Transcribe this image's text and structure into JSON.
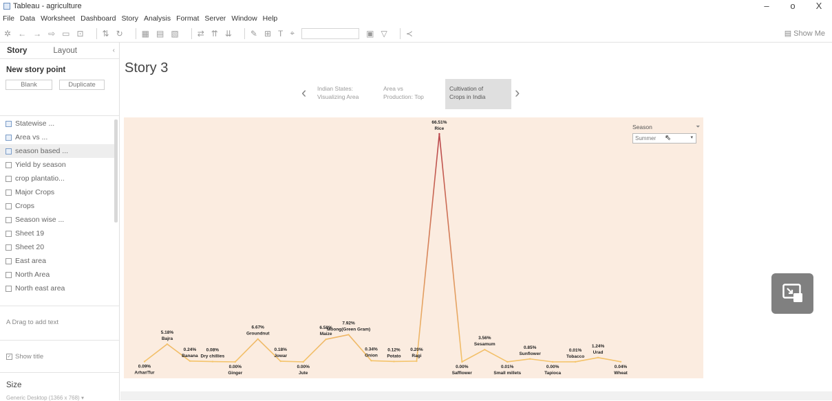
{
  "window": {
    "title": "Tableau - agriculture",
    "controls": [
      "–",
      "o",
      "X"
    ]
  },
  "menu": [
    "File",
    "Data",
    "Worksheet",
    "Dashboard",
    "Story",
    "Analysis",
    "Format",
    "Server",
    "Window",
    "Help"
  ],
  "toolbar": {
    "show_me": "Show Me"
  },
  "panel": {
    "tab_story": "Story",
    "tab_layout": "Layout",
    "new_story_point": "New story point",
    "blank": "Blank",
    "duplicate": "Duplicate",
    "sheets": [
      {
        "label": "Statewise ...",
        "kind": "story"
      },
      {
        "label": "Area vs ...",
        "kind": "story"
      },
      {
        "label": "season based ...",
        "kind": "story",
        "selected": true
      },
      {
        "label": "Yield by season",
        "kind": "sheet"
      },
      {
        "label": "crop plantatio...",
        "kind": "sheet"
      },
      {
        "label": "Major Crops",
        "kind": "sheet"
      },
      {
        "label": "Crops",
        "kind": "sheet"
      },
      {
        "label": "Season wise ...",
        "kind": "sheet"
      },
      {
        "label": "Sheet 19",
        "kind": "sheet"
      },
      {
        "label": "Sheet 20",
        "kind": "sheet"
      },
      {
        "label": "East area",
        "kind": "sheet"
      },
      {
        "label": "North Area",
        "kind": "sheet"
      },
      {
        "label": "North east area",
        "kind": "sheet"
      }
    ],
    "drag_text": "Drag to add text",
    "show_title": "Show title",
    "size_label": "Size",
    "size_value": "Generic Desktop (1366 x 768) ▾"
  },
  "story": {
    "title": "Story 3",
    "points": [
      {
        "line1": "Indian States:",
        "line2": "Visualizing Area"
      },
      {
        "line1": "Area vs",
        "line2": "Production: Top"
      },
      {
        "line1": "Cultivation of",
        "line2": "Crops in India",
        "active": true
      }
    ]
  },
  "filter": {
    "label": "Season",
    "value": "Summer"
  },
  "colors": {
    "canvas_bg": "#fbece0",
    "line_low": "#f5c56a",
    "line_high": "#b8424a"
  },
  "chart_data": {
    "type": "line",
    "categories": [
      "Arhar/Tur",
      "Bajra",
      "Banana",
      "Dry chillies",
      "Ginger",
      "Groundnut",
      "Jowar",
      "Jute",
      "Maize",
      "Moong(Green Gram)",
      "Onion",
      "Potato",
      "Ragi",
      "Rice",
      "Safflower",
      "Sesamum",
      "Small millets",
      "Sunflower",
      "Tapioca",
      "Tobacco",
      "Urad",
      "Wheat"
    ],
    "values": [
      0.09,
      5.18,
      0.24,
      0.08,
      0.0,
      6.67,
      0.18,
      0.0,
      6.58,
      7.92,
      0.34,
      0.12,
      0.2,
      66.51,
      0.0,
      3.56,
      0.01,
      0.85,
      0.0,
      0.01,
      1.24,
      0.04
    ],
    "value_labels": [
      "0.09%",
      "5.18%",
      "0.24%",
      "0.08%",
      "0.00%",
      "6.67%",
      "0.18%",
      "0.00%",
      "6.58%",
      "7.92%",
      "0.34%",
      "0.12%",
      "0.20%",
      "66.51%",
      "0.00%",
      "3.56%",
      "0.01%",
      "0.85%",
      "0.00%",
      "0.01%",
      "1.24%",
      "0.04%"
    ],
    "label_above": [
      false,
      true,
      true,
      true,
      false,
      true,
      true,
      false,
      true,
      true,
      true,
      true,
      true,
      true,
      false,
      true,
      false,
      true,
      false,
      true,
      true,
      false
    ],
    "ylim": [
      0,
      66.51
    ],
    "grid": false,
    "legend": "none"
  }
}
